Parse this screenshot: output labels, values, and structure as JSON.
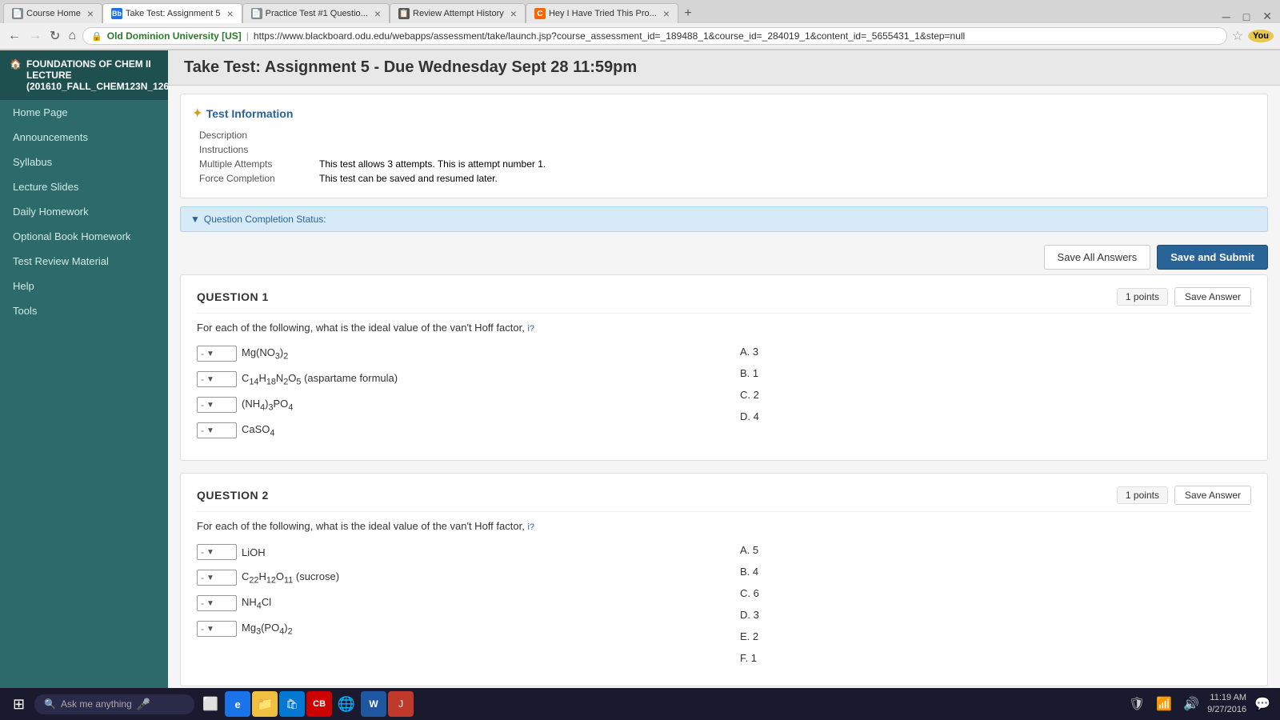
{
  "browser": {
    "tabs": [
      {
        "id": "t1",
        "icon_color": "#888",
        "icon_text": "📄",
        "title": "Course Home",
        "active": false
      },
      {
        "id": "t2",
        "icon_color": "#1a73e8",
        "icon_text": "Bb",
        "title": "Take Test: Assignment 5",
        "active": true
      },
      {
        "id": "t3",
        "icon_color": "#888",
        "icon_text": "📄",
        "title": "Practice Test #1 Questio...",
        "active": false
      },
      {
        "id": "t4",
        "icon_color": "#888",
        "icon_text": "📋",
        "title": "Review Attempt History",
        "active": false
      },
      {
        "id": "t5",
        "icon_color": "#f60",
        "icon_text": "C",
        "title": "Hey I Have Tried This Pro...",
        "active": false
      }
    ],
    "address": {
      "org": "Old Dominion University [US]",
      "url": "https://www.blackboard.odu.edu/webapps/assessment/take/launch.jsp?course_assessment_id=_189488_1&course_id=_284019_1&content_id=_5655431_1&step=null"
    }
  },
  "sidebar": {
    "course_title": "FOUNDATIONS OF CHEM II LECTURE (201610_FALL_CHEM123N_12614)",
    "nav_items": [
      {
        "label": "Home Page"
      },
      {
        "label": "Announcements"
      },
      {
        "label": "Syllabus"
      },
      {
        "label": "Lecture Slides"
      },
      {
        "label": "Daily Homework"
      },
      {
        "label": "Optional Book Homework"
      },
      {
        "label": "Test Review Material"
      },
      {
        "label": "Help"
      },
      {
        "label": "Tools"
      }
    ]
  },
  "page": {
    "title": "Take Test: Assignment 5 - Due Wednesday Sept 28 11:59pm",
    "test_info": {
      "header": "Test Information",
      "rows": [
        {
          "label": "Description",
          "value": ""
        },
        {
          "label": "Instructions",
          "value": ""
        },
        {
          "label": "Multiple Attempts",
          "value": "This test allows 3 attempts. This is attempt number 1."
        },
        {
          "label": "Force Completion",
          "value": "This test can be saved and resumed later."
        }
      ]
    },
    "completion_status_label": "Question Completion Status:",
    "buttons": {
      "save_all": "Save All Answers",
      "save_submit": "Save and Submit"
    },
    "questions": [
      {
        "id": "q1",
        "number": "QUESTION 1",
        "points": "1 points",
        "save_btn": "Save Answer",
        "prompt": "For each of the following, what is the ideal value of the van't Hoff factor,",
        "help_link": "i?",
        "compounds": [
          {
            "formula_html": "Mg(NO<sub>3</sub>)<sub>2</sub>"
          },
          {
            "formula_html": "C<sub>14</sub>H<sub>18</sub>N<sub>2</sub>O<sub>5</sub> (aspartame formula)"
          },
          {
            "formula_html": "(NH<sub>4</sub>)<sub>3</sub>PO<sub>4</sub>"
          },
          {
            "formula_html": "CaSO<sub>4</sub>"
          }
        ],
        "answers": [
          {
            "letter": "A.",
            "value": "3"
          },
          {
            "letter": "B.",
            "value": "1"
          },
          {
            "letter": "C.",
            "value": "2"
          },
          {
            "letter": "D.",
            "value": "4"
          }
        ]
      },
      {
        "id": "q2",
        "number": "QUESTION 2",
        "points": "1 points",
        "save_btn": "Save Answer",
        "prompt": "For each of the following, what is the ideal value of the van't Hoff factor,",
        "help_link": "i?",
        "compounds": [
          {
            "formula_html": "LiOH"
          },
          {
            "formula_html": "C<sub>22</sub>H<sub>12</sub>O<sub>11</sub> (sucrose)"
          },
          {
            "formula_html": "NH<sub>4</sub>Cl"
          },
          {
            "formula_html": "Mg<sub>3</sub>(PO<sub>4</sub>)<sub>2</sub>"
          }
        ],
        "answers": [
          {
            "letter": "A.",
            "value": "5"
          },
          {
            "letter": "B.",
            "value": "4"
          },
          {
            "letter": "C.",
            "value": "6"
          },
          {
            "letter": "D.",
            "value": "3"
          },
          {
            "letter": "E.",
            "value": "2"
          },
          {
            "letter": "F.",
            "value": "1"
          }
        ]
      }
    ]
  },
  "taskbar": {
    "search_placeholder": "Ask me anything",
    "clock": {
      "time": "11:19 AM",
      "date": "9/27/2016"
    }
  }
}
